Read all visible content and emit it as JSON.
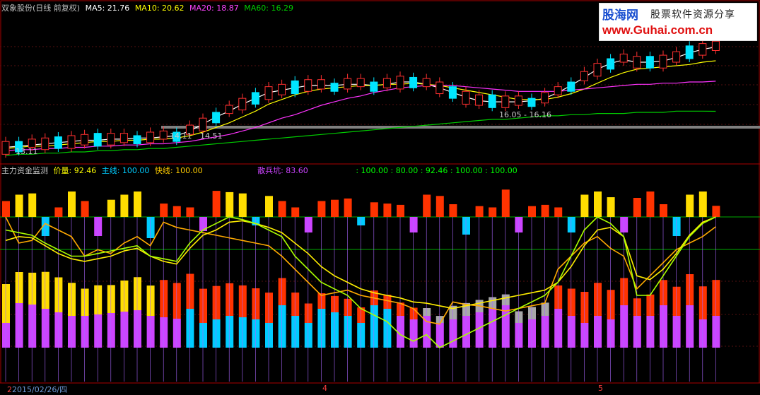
{
  "top_legend": {
    "stock": "双象股份(日线 前复权)",
    "ma5_label": "MA5: 21.76",
    "ma10_label": "MA10: 20.62",
    "ma20_label": "MA20: 18.87",
    "ma60_label": "MA60: 16.29",
    "colors": {
      "stock": "#c0c0c0",
      "ma5": "#ffffff",
      "ma10": "#ffff00",
      "ma20": "#ff00ff",
      "ma60": "#00cc00"
    }
  },
  "watermark": {
    "title": "股海网",
    "subtitle": "股票软件资源分享",
    "url": "www.Guhai.com.cn"
  },
  "mid_legend": {
    "name": "主力资金监测",
    "jialiang": "价量: 92.46",
    "zhuxian": "主线: 100.00",
    "kuaixian": "快线: 100.00",
    "sanbingkeng": "散兵坑: 83.60",
    "extra": ": 100.00 : 80.00 : 92.46 : 100.00 : 100.00",
    "colors": {
      "jialiang": "#ffff00",
      "zhuxian": "#00ccff",
      "kuaixian": "#ffcc00",
      "sanbingkeng": "#cc44ff",
      "extra": "#00ff00"
    }
  },
  "annotations": {
    "low_a": "14.11",
    "low_b": "14.51",
    "range": "16.05 - 16.16",
    "left_tag": "13.11"
  },
  "x_axis": {
    "start_date": "2015/02/26/四",
    "month_4": "4",
    "month_5": "5",
    "month_tag": "2"
  },
  "chart_data": [
    {
      "type": "candlestick",
      "title": "双象股份(日线 前复权)",
      "series": [
        {
          "name": "MA5",
          "values": [
            13.2,
            13.3,
            13.4,
            13.5,
            13.6,
            13.7,
            13.8,
            13.8,
            13.9,
            13.9,
            14.0,
            14.0,
            14.1,
            14.2,
            14.6,
            15.2,
            15.8,
            16.3,
            16.9,
            17.4,
            17.9,
            18.1,
            18.3,
            18.5,
            18.5,
            18.5,
            18.6,
            18.6,
            18.5,
            18.6,
            18.8,
            18.8,
            18.6,
            18.3,
            17.9,
            17.5,
            17.2,
            17.1,
            17.1,
            17.1,
            17.2,
            17.4,
            17.9,
            18.5,
            19.2,
            19.9,
            20.4,
            20.7,
            20.5,
            20.5,
            20.6,
            20.9,
            21.3,
            21.6,
            21.8
          ]
        },
        {
          "name": "MA10",
          "values": [
            13.1,
            13.2,
            13.3,
            13.3,
            13.4,
            13.5,
            13.6,
            13.7,
            13.7,
            13.8,
            13.8,
            13.9,
            13.9,
            14.0,
            14.2,
            14.5,
            14.9,
            15.3,
            15.8,
            16.3,
            16.9,
            17.3,
            17.7,
            18.0,
            18.2,
            18.3,
            18.4,
            18.5,
            18.5,
            18.6,
            18.6,
            18.7,
            18.6,
            18.5,
            18.3,
            18.1,
            17.9,
            17.7,
            17.5,
            17.3,
            17.3,
            17.3,
            17.5,
            17.8,
            18.2,
            18.7,
            19.2,
            19.6,
            19.9,
            20.0,
            20.1,
            20.2,
            20.3,
            20.5,
            20.62
          ]
        },
        {
          "name": "MA20",
          "values": [
            12.9,
            13.0,
            13.0,
            13.1,
            13.1,
            13.2,
            13.2,
            13.3,
            13.3,
            13.4,
            13.4,
            13.5,
            13.5,
            13.6,
            13.7,
            13.9,
            14.1,
            14.3,
            14.6,
            14.9,
            15.3,
            15.7,
            16.0,
            16.4,
            16.8,
            17.1,
            17.4,
            17.6,
            17.9,
            18.1,
            18.3,
            18.4,
            18.5,
            18.5,
            18.5,
            18.4,
            18.3,
            18.2,
            18.1,
            18.0,
            18.0,
            18.0,
            18.0,
            18.1,
            18.2,
            18.3,
            18.4,
            18.5,
            18.6,
            18.6,
            18.7,
            18.7,
            18.8,
            18.8,
            18.87
          ]
        },
        {
          "name": "MA60",
          "values": [
            12.5,
            12.6,
            12.6,
            12.7,
            12.7,
            12.8,
            12.8,
            12.9,
            12.9,
            13.0,
            13.0,
            13.1,
            13.1,
            13.2,
            13.3,
            13.4,
            13.5,
            13.6,
            13.7,
            13.8,
            13.9,
            14.0,
            14.1,
            14.2,
            14.3,
            14.4,
            14.5,
            14.6,
            14.7,
            14.8,
            14.9,
            15.0,
            15.1,
            15.2,
            15.3,
            15.4,
            15.5,
            15.6,
            15.6,
            15.7,
            15.8,
            15.9,
            15.9,
            16.0,
            16.0,
            16.1,
            16.1,
            16.1,
            16.2,
            16.2,
            16.2,
            16.3,
            16.3,
            16.3,
            16.29
          ]
        }
      ]
    },
    {
      "type": "bar",
      "title": "主力资金监测",
      "series": [
        {
          "name": "价量",
          "values": [
            100,
            80,
            82,
            95,
            90,
            85,
            70,
            75,
            72,
            80,
            85,
            78,
            96,
            92,
            90,
            88,
            86,
            84,
            82,
            80,
            78,
            70,
            60,
            50,
            40,
            42,
            44,
            40,
            38,
            36,
            34,
            30,
            20,
            18,
            35,
            33,
            32,
            30,
            28,
            30,
            32,
            34,
            60,
            70,
            80,
            85,
            76,
            70,
            45,
            55,
            65,
            75,
            80,
            85,
            92.46
          ]
        },
        {
          "name": "主线",
          "values": [
            90,
            88,
            86,
            80,
            75,
            70,
            70,
            72,
            74,
            76,
            78,
            70,
            68,
            66,
            80,
            90,
            95,
            100,
            98,
            95,
            90,
            85,
            70,
            60,
            50,
            45,
            40,
            30,
            25,
            20,
            10,
            5,
            10,
            0,
            5,
            10,
            15,
            20,
            25,
            30,
            35,
            40,
            50,
            70,
            90,
            100,
            95,
            85,
            40,
            40,
            55,
            70,
            85,
            95,
            100
          ]
        },
        {
          "name": "快线",
          "values": [
            82,
            85,
            84,
            78,
            72,
            68,
            66,
            68,
            70,
            74,
            76,
            70,
            66,
            64,
            76,
            86,
            90,
            96,
            97,
            95,
            92,
            88,
            80,
            72,
            62,
            55,
            50,
            45,
            42,
            40,
            38,
            35,
            34,
            32,
            30,
            32,
            34,
            36,
            38,
            40,
            42,
            44,
            50,
            62,
            78,
            90,
            92,
            85,
            55,
            52,
            60,
            72,
            86,
            96,
            100
          ]
        },
        {
          "name": "散兵坑",
          "values": [
            83.6
          ]
        }
      ]
    }
  ]
}
